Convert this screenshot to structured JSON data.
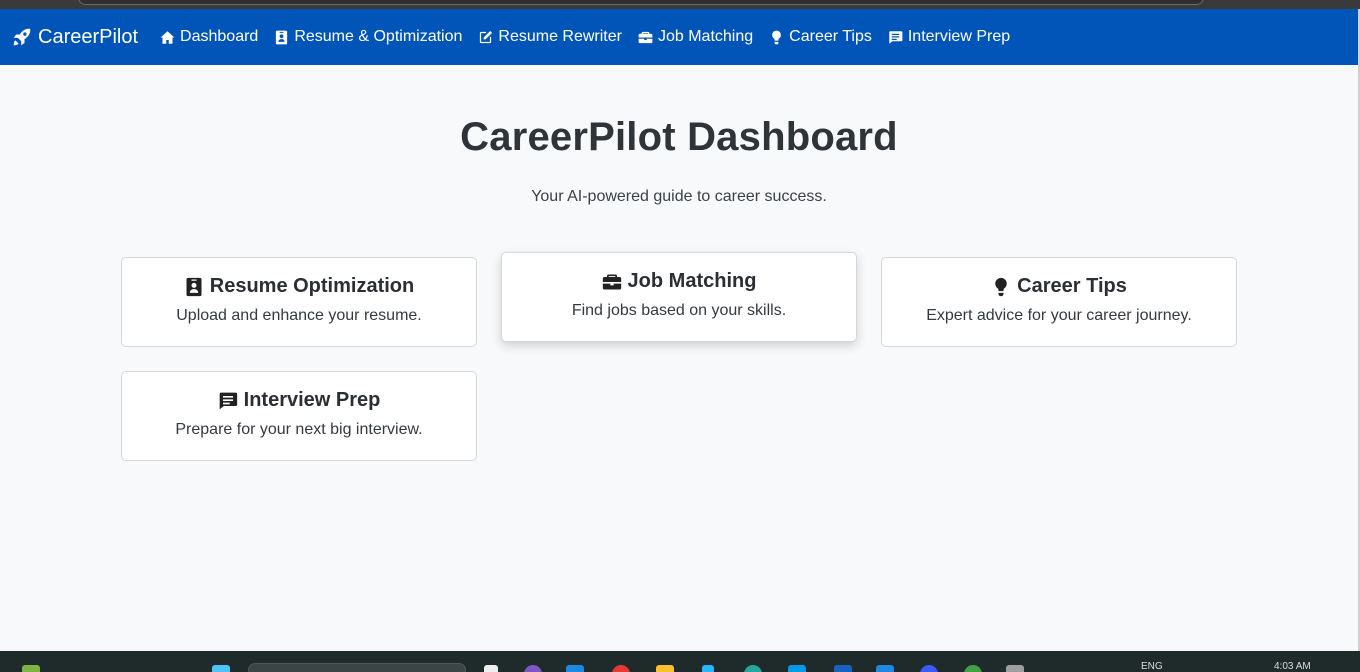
{
  "app": {
    "brand": "CareerPilot"
  },
  "nav": {
    "items": [
      {
        "label": "Dashboard",
        "icon": "home-icon"
      },
      {
        "label": "Resume & Optimization",
        "icon": "id-badge-icon"
      },
      {
        "label": "Resume Rewriter",
        "icon": "edit-icon"
      },
      {
        "label": "Job Matching",
        "icon": "briefcase-icon"
      },
      {
        "label": "Career Tips",
        "icon": "lightbulb-icon"
      },
      {
        "label": "Interview Prep",
        "icon": "comment-icon"
      }
    ]
  },
  "hero": {
    "title": "CareerPilot Dashboard",
    "subtitle": "Your AI-powered guide to career success."
  },
  "cards": [
    {
      "title": "Resume Optimization",
      "text": "Upload and enhance your resume.",
      "icon": "id-badge-icon"
    },
    {
      "title": "Job Matching",
      "text": "Find jobs based on your skills.",
      "icon": "briefcase-icon"
    },
    {
      "title": "Career Tips",
      "text": "Expert advice for your career journey.",
      "icon": "lightbulb-icon"
    },
    {
      "title": "Interview Prep",
      "text": "Prepare for your next big interview.",
      "icon": "comment-icon"
    }
  ],
  "taskbar": {
    "lang": "ENG",
    "time": "4:03 AM"
  },
  "colors": {
    "navbar": "#0255b8",
    "page_bg": "#f8f9fa"
  }
}
